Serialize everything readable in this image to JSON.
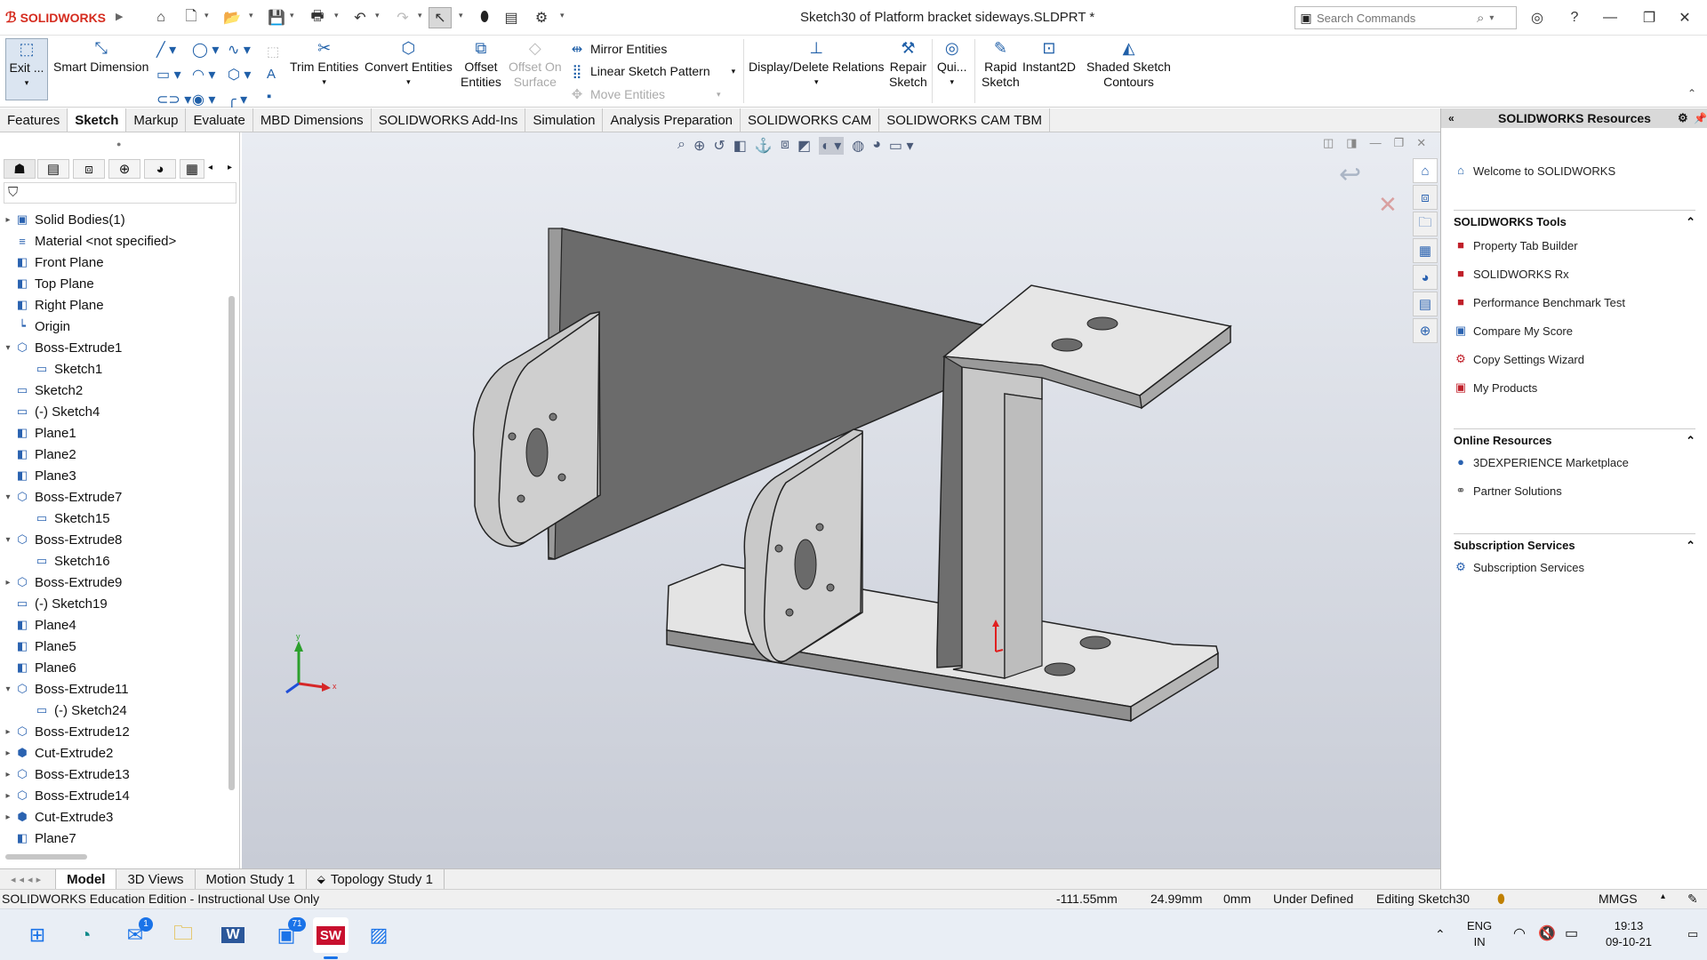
{
  "app": {
    "brand": "SOLIDWORKS",
    "title": "Sketch30 of Platform bracket sideways.SLDPRT *"
  },
  "search": {
    "placeholder": "Search Commands"
  },
  "commands": {
    "exit": "Exit ...",
    "smart_dimension": "Smart Dimension",
    "trim": "Trim Entities",
    "convert": "Convert Entities",
    "offset_l1": "Offset",
    "offset_l2": "Entities",
    "offset_surface_l1": "Offset On",
    "offset_surface_l2": "Surface",
    "mirror": "Mirror Entities",
    "linear_pattern": "Linear Sketch Pattern",
    "move": "Move Entities",
    "display_relations": "Display/Delete Relations",
    "repair_l1": "Repair",
    "repair_l2": "Sketch",
    "quick": "Qui...",
    "rapid_l1": "Rapid",
    "rapid_l2": "Sketch",
    "instant2d": "Instant2D",
    "shaded_l1": "Shaded Sketch",
    "shaded_l2": "Contours"
  },
  "tabs": [
    "Features",
    "Sketch",
    "Markup",
    "Evaluate",
    "MBD Dimensions",
    "SOLIDWORKS Add-Ins",
    "Simulation",
    "Analysis Preparation",
    "SOLIDWORKS CAM",
    "SOLIDWORKS CAM TBM"
  ],
  "tree": [
    {
      "label": "Solid Bodies(1)",
      "icon": "folder-icon",
      "indent": 0,
      "exp": "▸"
    },
    {
      "label": "Material <not specified>",
      "icon": "material-icon",
      "indent": 0,
      "exp": ""
    },
    {
      "label": "Front Plane",
      "icon": "plane-icon",
      "indent": 0,
      "exp": ""
    },
    {
      "label": "Top Plane",
      "icon": "plane-icon",
      "indent": 0,
      "exp": ""
    },
    {
      "label": "Right Plane",
      "icon": "plane-icon",
      "indent": 0,
      "exp": ""
    },
    {
      "label": "Origin",
      "icon": "origin-icon",
      "indent": 0,
      "exp": ""
    },
    {
      "label": "Boss-Extrude1",
      "icon": "extrude-icon",
      "indent": 0,
      "exp": "▾"
    },
    {
      "label": "Sketch1",
      "icon": "sketch-icon",
      "indent": 1,
      "exp": ""
    },
    {
      "label": "Sketch2",
      "icon": "sketch-icon",
      "indent": 0,
      "exp": ""
    },
    {
      "label": "(-) Sketch4",
      "icon": "sketch-icon",
      "indent": 0,
      "exp": ""
    },
    {
      "label": "Plane1",
      "icon": "plane-icon",
      "indent": 0,
      "exp": ""
    },
    {
      "label": "Plane2",
      "icon": "plane-icon",
      "indent": 0,
      "exp": ""
    },
    {
      "label": "Plane3",
      "icon": "plane-icon",
      "indent": 0,
      "exp": ""
    },
    {
      "label": "Boss-Extrude7",
      "icon": "extrude-icon",
      "indent": 0,
      "exp": "▾"
    },
    {
      "label": "Sketch15",
      "icon": "sketch-icon",
      "indent": 1,
      "exp": ""
    },
    {
      "label": "Boss-Extrude8",
      "icon": "extrude-icon",
      "indent": 0,
      "exp": "▾"
    },
    {
      "label": "Sketch16",
      "icon": "sketch-icon",
      "indent": 1,
      "exp": ""
    },
    {
      "label": "Boss-Extrude9",
      "icon": "extrude-icon",
      "indent": 0,
      "exp": "▸"
    },
    {
      "label": "(-) Sketch19",
      "icon": "sketch-icon",
      "indent": 0,
      "exp": ""
    },
    {
      "label": "Plane4",
      "icon": "plane-icon",
      "indent": 0,
      "exp": ""
    },
    {
      "label": "Plane5",
      "icon": "plane-icon",
      "indent": 0,
      "exp": ""
    },
    {
      "label": "Plane6",
      "icon": "plane-icon",
      "indent": 0,
      "exp": ""
    },
    {
      "label": "Boss-Extrude11",
      "icon": "extrude-icon",
      "indent": 0,
      "exp": "▾"
    },
    {
      "label": "(-) Sketch24",
      "icon": "sketch-icon",
      "indent": 1,
      "exp": ""
    },
    {
      "label": "Boss-Extrude12",
      "icon": "extrude-icon",
      "indent": 0,
      "exp": "▸"
    },
    {
      "label": "Cut-Extrude2",
      "icon": "cut-icon",
      "indent": 0,
      "exp": "▸"
    },
    {
      "label": "Boss-Extrude13",
      "icon": "extrude-icon",
      "indent": 0,
      "exp": "▸"
    },
    {
      "label": "Boss-Extrude14",
      "icon": "extrude-icon",
      "indent": 0,
      "exp": "▸"
    },
    {
      "label": "Cut-Extrude3",
      "icon": "cut-icon",
      "indent": 0,
      "exp": "▸"
    },
    {
      "label": "Plane7",
      "icon": "plane-icon",
      "indent": 0,
      "exp": ""
    }
  ],
  "triad": {
    "x": "x",
    "y": "y"
  },
  "resources": {
    "title": "SOLIDWORKS Resources",
    "welcome": "Welcome to SOLIDWORKS",
    "tools_header": "SOLIDWORKS Tools",
    "tools": [
      "Property Tab Builder",
      "SOLIDWORKS Rx",
      "Performance Benchmark Test",
      "Compare My Score",
      "Copy Settings Wizard",
      "My Products"
    ],
    "online_header": "Online Resources",
    "online": [
      "3DEXPERIENCE Marketplace",
      "Partner Solutions"
    ],
    "subs_header": "Subscription Services",
    "subs": [
      "Subscription Services"
    ]
  },
  "bottom_tabs": [
    "Model",
    "3D Views",
    "Motion Study 1",
    "Topology Study 1"
  ],
  "status": {
    "edition": "SOLIDWORKS Education Edition - Instructional Use Only",
    "x": "-111.55mm",
    "y": "24.99mm",
    "z": "0mm",
    "state": "Under Defined",
    "editing": "Editing Sketch30",
    "units": "MMGS"
  },
  "taskbar": {
    "lang1": "ENG",
    "lang2": "IN",
    "time": "19:13",
    "date": "09-10-21",
    "mail_badge": "1",
    "teams_badge": "71"
  }
}
